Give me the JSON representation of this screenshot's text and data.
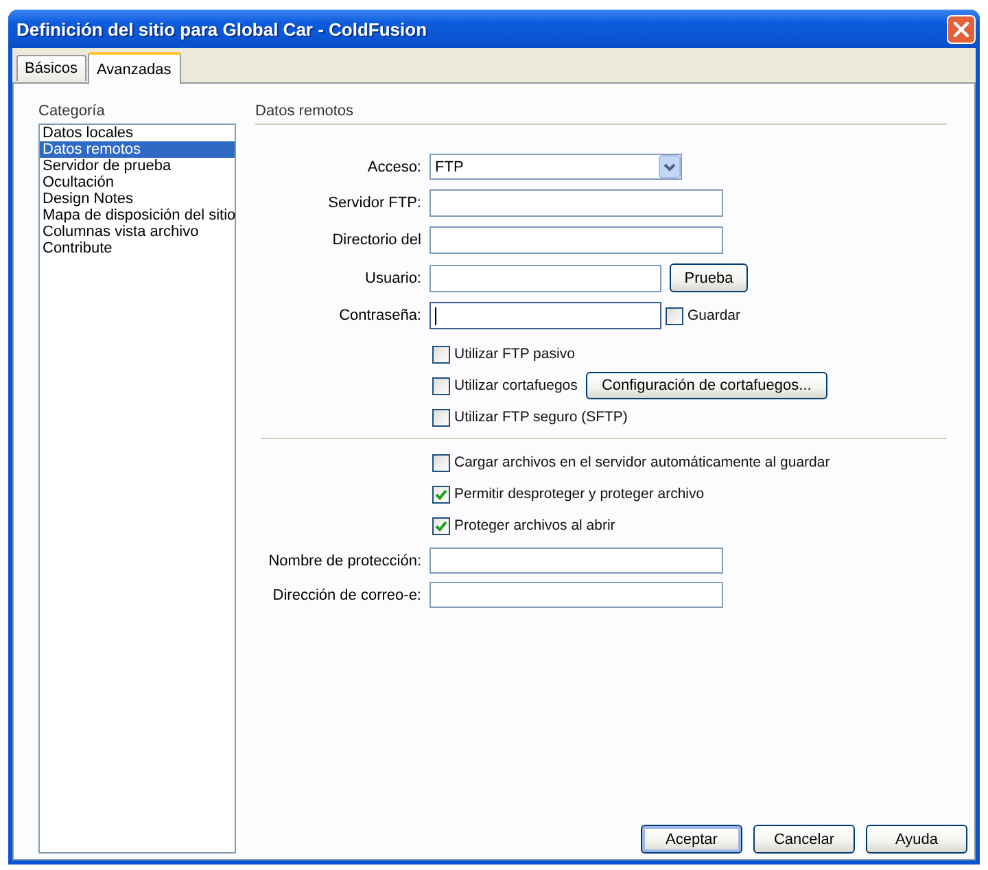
{
  "window": {
    "title": "Definición del sitio para Global Car - ColdFusion"
  },
  "tabs": [
    {
      "label": "Básicos",
      "selected": false
    },
    {
      "label": "Avanzadas",
      "selected": true
    }
  ],
  "category": {
    "heading": "Categoría",
    "items": [
      {
        "label": "Datos locales",
        "selected": false
      },
      {
        "label": "Datos remotos",
        "selected": true
      },
      {
        "label": "Servidor de prueba",
        "selected": false
      },
      {
        "label": "Ocultación",
        "selected": false
      },
      {
        "label": "Design Notes",
        "selected": false
      },
      {
        "label": "Mapa de disposición del sitio",
        "selected": false
      },
      {
        "label": "Columnas vista archivo",
        "selected": false
      },
      {
        "label": "Contribute",
        "selected": false
      }
    ]
  },
  "remote": {
    "heading": "Datos remotos",
    "fields": [
      {
        "kind": "select",
        "label": "Acceso:",
        "value": "FTP",
        "focused": false
      },
      {
        "kind": "text",
        "label": "Servidor FTP:",
        "focused": false
      },
      {
        "kind": "text",
        "label": "Directorio del",
        "focused": false
      },
      {
        "kind": "text",
        "label": "Usuario:",
        "focused": false,
        "button": "Prueba"
      },
      {
        "kind": "text",
        "label": "Contraseña:",
        "focused": true,
        "checkbox": {
          "label": "Guardar",
          "checked": false
        }
      }
    ],
    "options": [
      {
        "label": "Utilizar FTP pasivo",
        "checked": false
      },
      {
        "label": "Utilizar cortafuegos",
        "checked": false,
        "button": "Configuración de cortafuegos..."
      },
      {
        "label": "Utilizar FTP seguro (SFTP)",
        "checked": false
      }
    ],
    "checkin_options": [
      {
        "label": "Cargar archivos en el servidor automáticamente al guardar",
        "checked": false
      },
      {
        "label": "Permitir desproteger y proteger archivo",
        "checked": true
      },
      {
        "label": "Proteger archivos al abrir",
        "checked": true
      }
    ],
    "checkin_fields": [
      {
        "kind": "text",
        "label": "Nombre de protección:"
      },
      {
        "kind": "text",
        "label": "Dirección de correo-e:"
      }
    ]
  },
  "buttons": [
    {
      "label": "Aceptar",
      "default": true
    },
    {
      "label": "Cancelar",
      "default": false
    },
    {
      "label": "Ayuda",
      "default": false
    }
  ]
}
